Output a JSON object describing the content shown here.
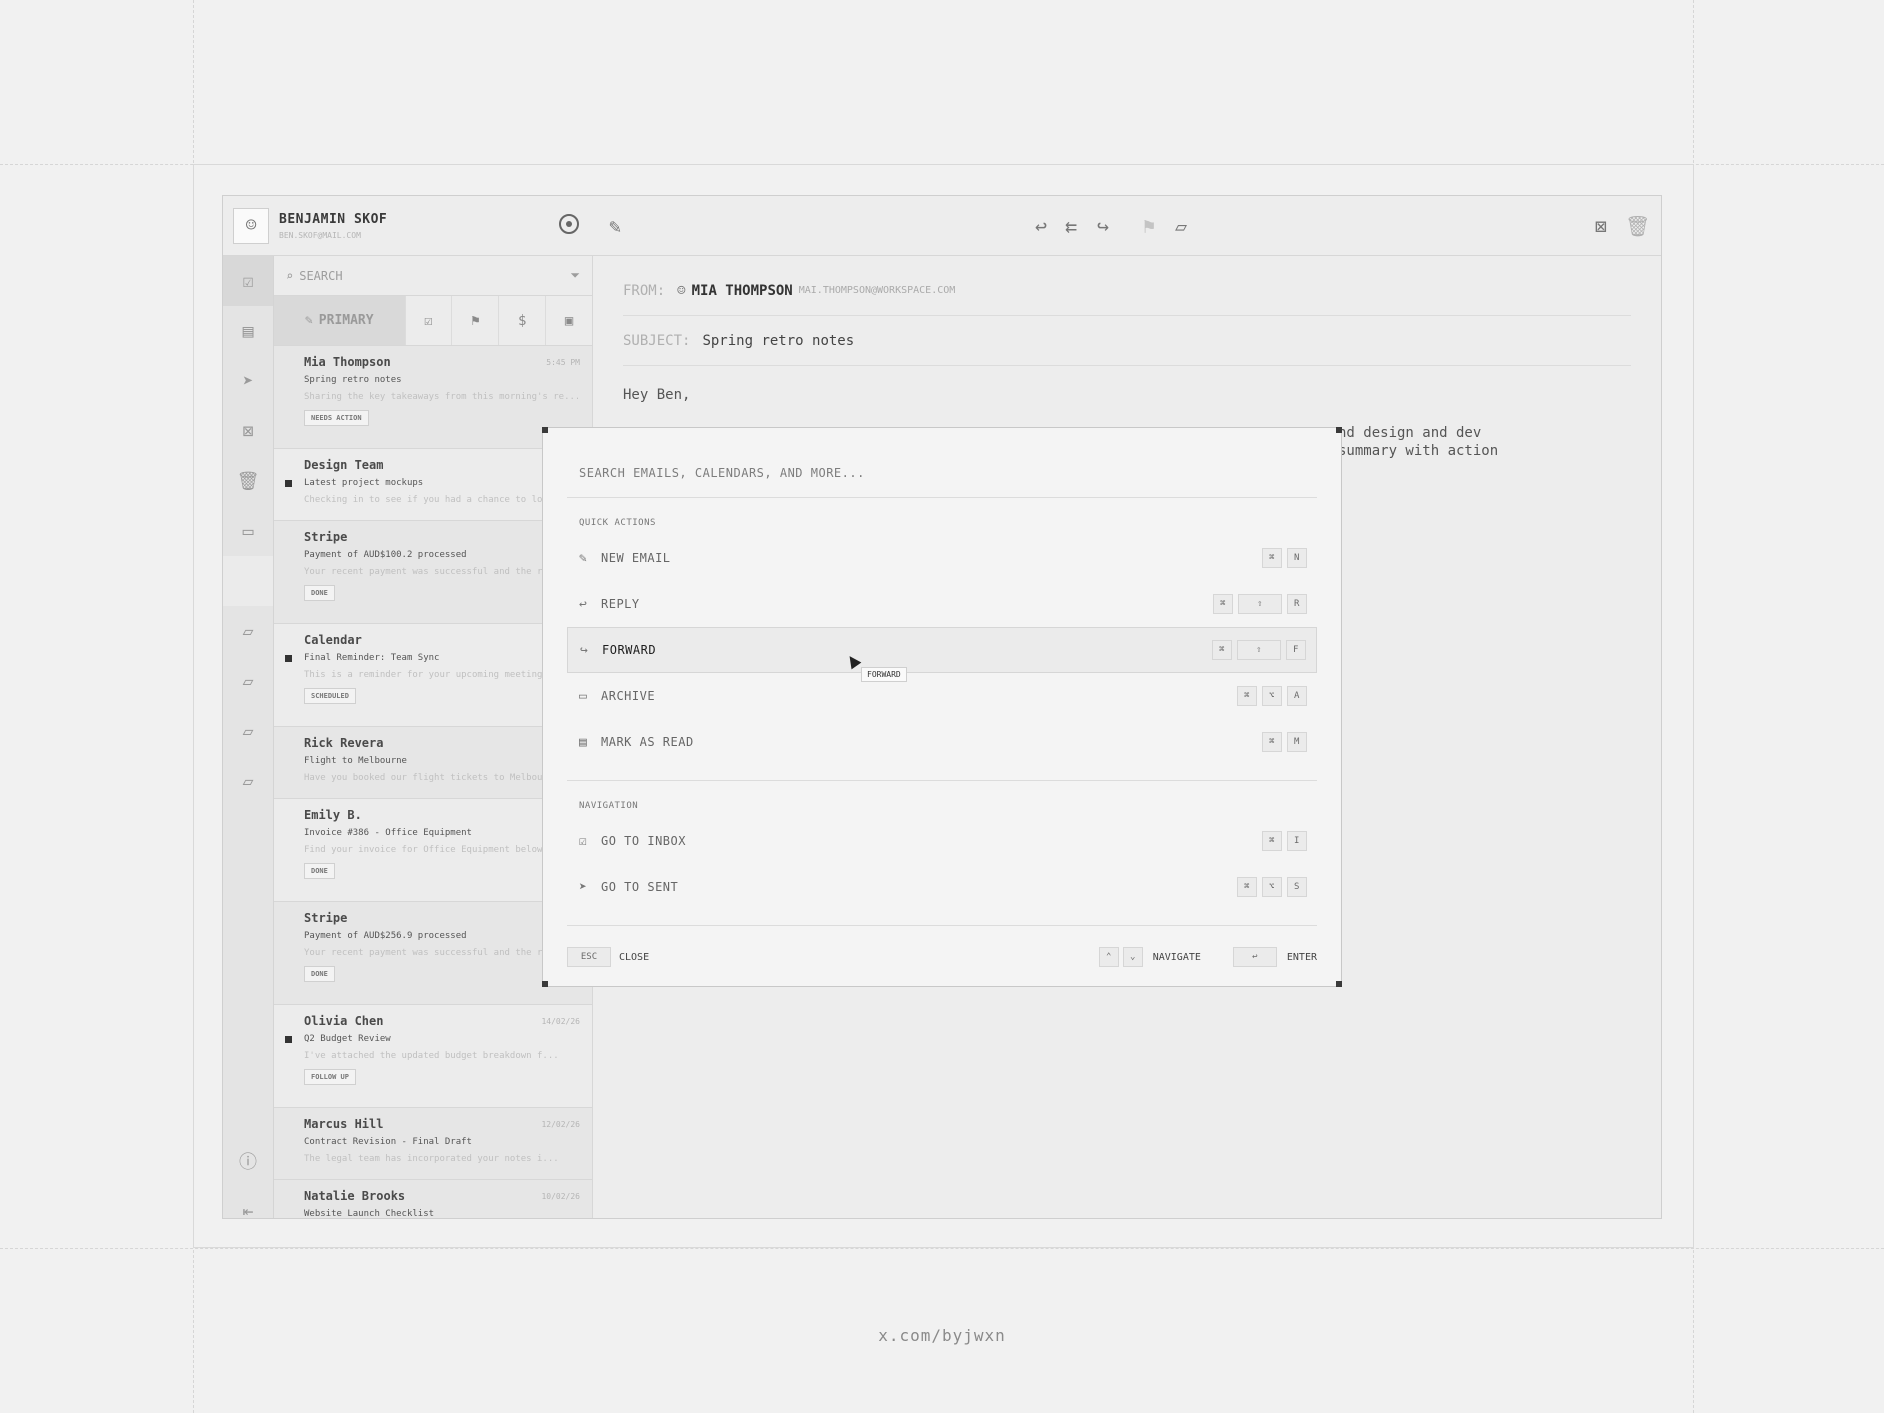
{
  "credit": "x.com/byjwxn",
  "profile": {
    "name": "BENJAMIN SKOF",
    "email": "BEN.SKOF@MAIL.COM"
  },
  "search": {
    "placeholder": "SEARCH"
  },
  "tabs": {
    "primary": "PRIMARY"
  },
  "emails": [
    {
      "sender": "Mia Thompson",
      "time": "5:45 PM",
      "subject": "Spring retro notes",
      "preview": "Sharing the key takeaways from this morning's re...",
      "tag": "NEEDS ACTION",
      "unread": false
    },
    {
      "sender": "Design Team",
      "time": "",
      "subject": "Latest project mockups",
      "preview": "Checking in to see if you had a chance to lo",
      "tag": "",
      "unread": true
    },
    {
      "sender": "Stripe",
      "time": "",
      "subject": "Payment of AUD$100.2 processed",
      "preview": "Your recent payment was successful and the r",
      "tag": "DONE",
      "unread": false
    },
    {
      "sender": "Calendar",
      "time": "",
      "subject": "Final Reminder: Team Sync",
      "preview": "This is a reminder for your upcoming meeting",
      "tag": "SCHEDULED",
      "unread": true
    },
    {
      "sender": "Rick Revera",
      "time": "",
      "subject": "Flight to Melbourne",
      "preview": "Have you booked our flight tickets to Melbour",
      "tag": "",
      "unread": false
    },
    {
      "sender": "Emily B.",
      "time": "",
      "subject": "Invoice #386 - Office Equipment",
      "preview": "Find your invoice for Office Equipment below",
      "tag": "DONE",
      "unread": false
    },
    {
      "sender": "Stripe",
      "time": "",
      "subject": "Payment of AUD$256.9 processed",
      "preview": "Your recent payment was successful and the r",
      "tag": "DONE",
      "unread": false
    },
    {
      "sender": "Olivia Chen",
      "time": "14/02/26",
      "subject": "Q2 Budget Review",
      "preview": "I've attached the updated budget breakdown f...",
      "tag": "FOLLOW UP",
      "unread": true
    },
    {
      "sender": "Marcus Hill",
      "time": "12/02/26",
      "subject": "Contract Revision - Final Draft",
      "preview": "The legal team has incorporated your notes i...",
      "tag": "",
      "unread": false
    },
    {
      "sender": "Natalie Brooks",
      "time": "10/02/26",
      "subject": "Website Launch Checklist",
      "preview": "",
      "tag": "",
      "unread": false
    }
  ],
  "reader": {
    "from_label": "FROM:",
    "from_name": "MIA THOMPSON",
    "from_email": "MAI.THOMPSON@WORKSPACE.COM",
    "subject_label": "SUBJECT:",
    "subject": "Spring retro notes",
    "greeting": "Hey Ben,",
    "body_line1": "nd design and dev",
    "body_line2": "summary with action"
  },
  "palette": {
    "search_placeholder": "SEARCH EMAILS, CALENDARS, AND MORE...",
    "quick_actions": "QUICK ACTIONS",
    "navigation": "NAVIGATION",
    "actions": [
      {
        "label": "NEW EMAIL",
        "keys": [
          "⌘",
          "N"
        ]
      },
      {
        "label": "REPLY",
        "keys": [
          "⌘",
          "⇧",
          "R"
        ]
      },
      {
        "label": "FORWARD",
        "keys": [
          "⌘",
          "⇧",
          "F"
        ]
      },
      {
        "label": "ARCHIVE",
        "keys": [
          "⌘",
          "⌥",
          "A"
        ]
      },
      {
        "label": "MARK AS READ",
        "keys": [
          "⌘",
          "M"
        ]
      }
    ],
    "nav": [
      {
        "label": "GO TO INBOX",
        "keys": [
          "⌘",
          "I"
        ]
      },
      {
        "label": "GO TO SENT",
        "keys": [
          "⌘",
          "⌥",
          "S"
        ]
      }
    ],
    "tooltip": "FORWARD",
    "footer": {
      "esc": "ESC",
      "close": "CLOSE",
      "navigate": "NAVIGATE",
      "enter_key": "↩",
      "enter": "ENTER"
    }
  }
}
